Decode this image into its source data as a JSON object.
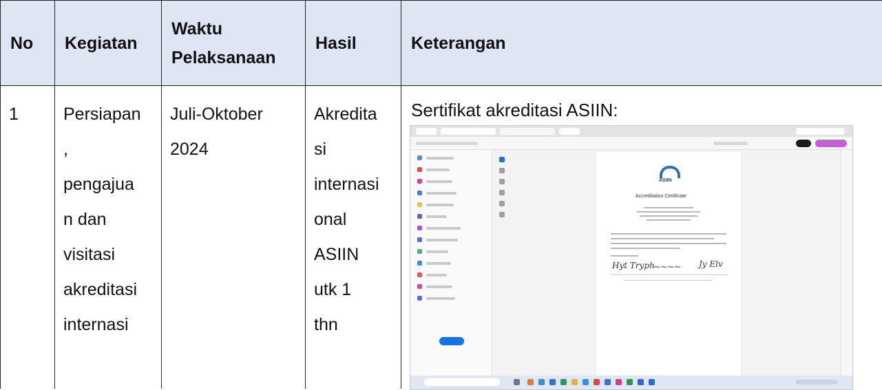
{
  "table": {
    "headers": {
      "no": "No",
      "kegiatan": "Kegiatan",
      "waktu": [
        "Waktu",
        "Pelaksanaan"
      ],
      "hasil": "Hasil",
      "keterangan": "Keterangan"
    },
    "rows": [
      {
        "no": "1",
        "kegiatan_lines": [
          ",",
          "pengajua",
          "n dan",
          "visitasi",
          "akreditasi",
          "internasi"
        ],
        "kegiatan_first": "Persiapan",
        "waktu_lines": [
          "Juli-Oktober",
          "2024"
        ],
        "hasil_lines": [
          "Akredita",
          "si",
          "internasi",
          "onal",
          "ASIIN",
          "utk 1",
          "thn"
        ],
        "keterangan_title": "Sertifikat akreditasi ASIIN:"
      }
    ]
  },
  "embedded_screenshot": {
    "logo_text": "ASIIN",
    "doc_title": "Accreditation Certificate",
    "accent_color": "#1473e6",
    "logo_color": "#2f6fb5"
  }
}
